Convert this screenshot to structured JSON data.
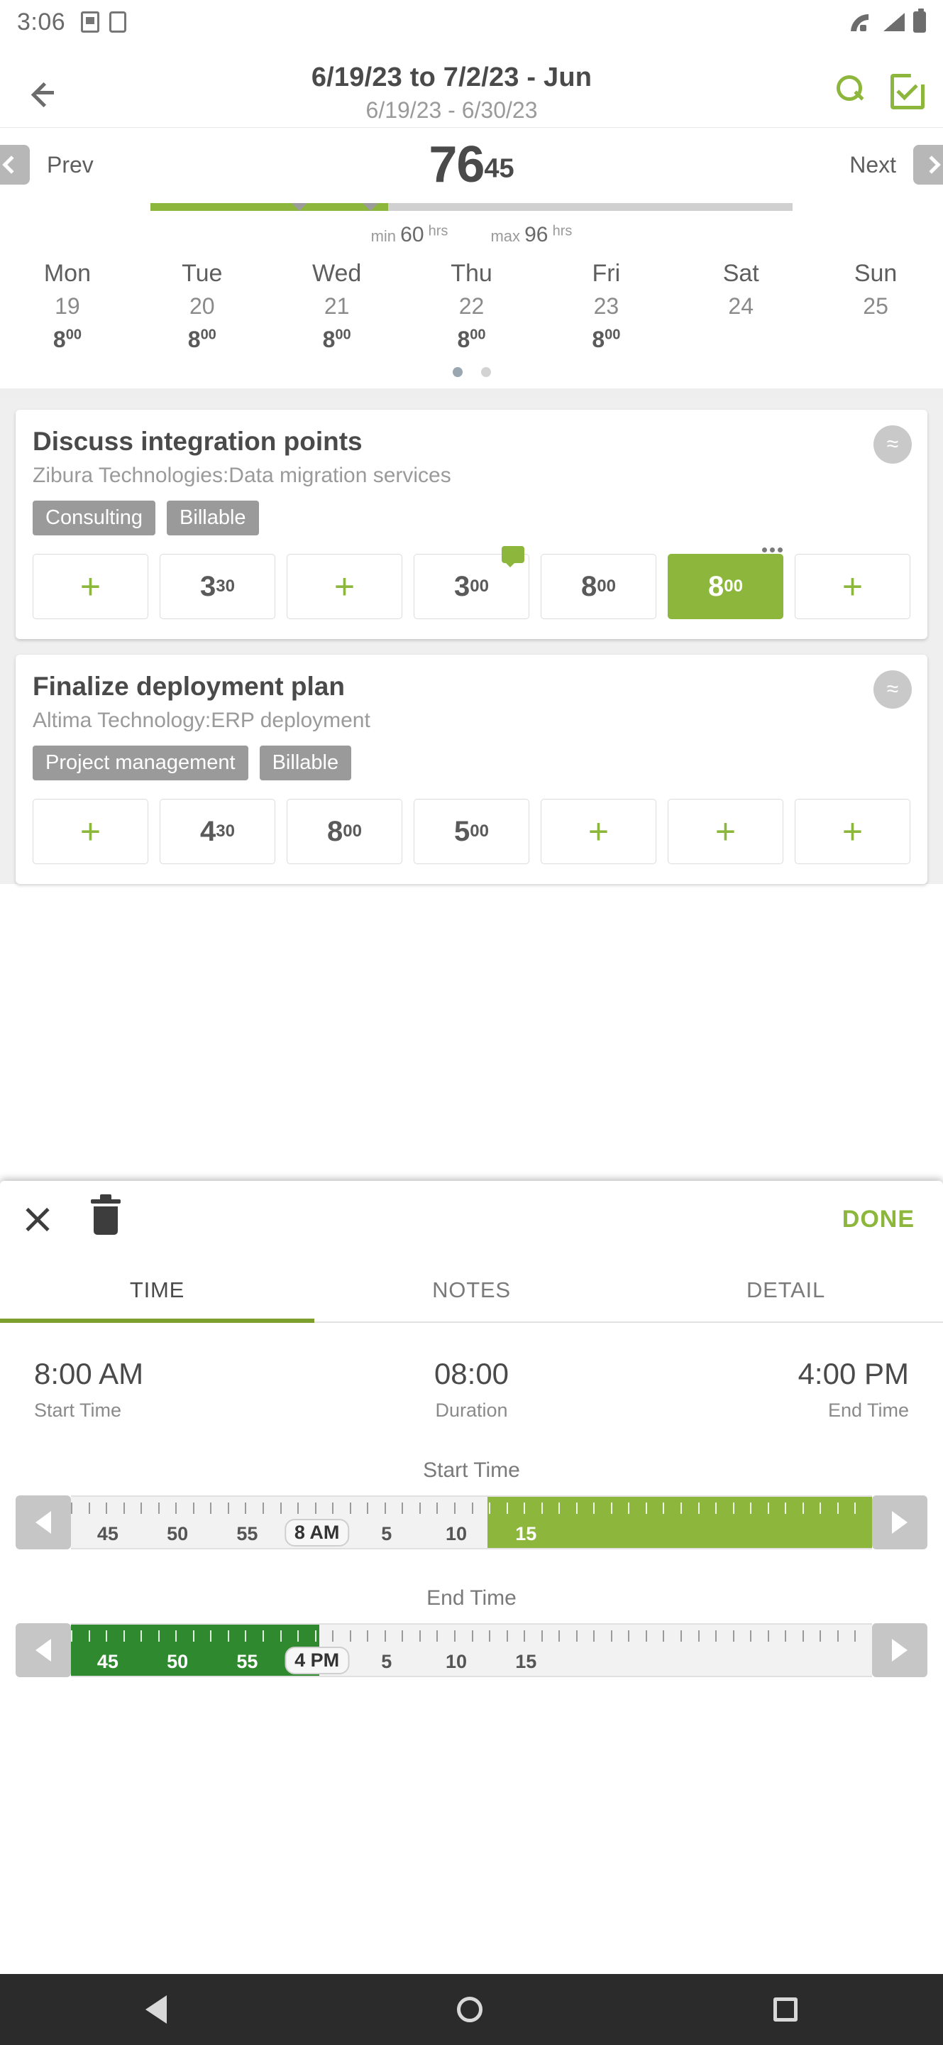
{
  "statusbar": {
    "time": "3:06"
  },
  "header": {
    "title": "6/19/23 to 7/2/23 - Jun",
    "subtitle": "6/19/23 - 6/30/23",
    "back_icon": "back-arrow-icon",
    "search_icon": "search-icon",
    "approve_icon": "checklist-icon"
  },
  "week": {
    "prev_label": "Prev",
    "next_label": "Next",
    "total_hours": "76",
    "total_minutes": "45",
    "min_label": "min",
    "min_value": "60",
    "min_unit": "hrs",
    "max_label": "max",
    "max_value": "96",
    "max_unit": "hrs",
    "progress_pct": 37,
    "marker_positions": [
      22,
      33
    ],
    "days": [
      {
        "name": "Mon",
        "date": "19",
        "hours": "8",
        "minutes": "00"
      },
      {
        "name": "Tue",
        "date": "20",
        "hours": "8",
        "minutes": "00"
      },
      {
        "name": "Wed",
        "date": "21",
        "hours": "8",
        "minutes": "00"
      },
      {
        "name": "Thu",
        "date": "22",
        "hours": "8",
        "minutes": "00"
      },
      {
        "name": "Fri",
        "date": "23",
        "hours": "8",
        "minutes": "00"
      },
      {
        "name": "Sat",
        "date": "24",
        "hours": "",
        "minutes": ""
      },
      {
        "name": "Sun",
        "date": "25",
        "hours": "",
        "minutes": ""
      }
    ],
    "page_dots": 2,
    "active_dot": 0
  },
  "tasks": [
    {
      "title": "Discuss integration points",
      "project": "Zibura Technologies:Data migration services",
      "tags": [
        "Consulting",
        "Billable"
      ],
      "collapse_glyph": "≈",
      "slots": [
        {
          "type": "add",
          "label": "+"
        },
        {
          "type": "value",
          "hours": "3",
          "minutes": "30"
        },
        {
          "type": "add",
          "label": "+"
        },
        {
          "type": "value",
          "hours": "3",
          "minutes": "00",
          "note": true
        },
        {
          "type": "value",
          "hours": "8",
          "minutes": "00"
        },
        {
          "type": "value",
          "hours": "8",
          "minutes": "00",
          "selected": true,
          "dots": true
        },
        {
          "type": "add",
          "label": "+"
        }
      ]
    },
    {
      "title": "Finalize deployment plan",
      "project": "Altima Technology:ERP deployment",
      "tags": [
        "Project management",
        "Billable"
      ],
      "collapse_glyph": "≈",
      "slots": [
        {
          "type": "add",
          "label": "+"
        },
        {
          "type": "value",
          "hours": "4",
          "minutes": "30"
        },
        {
          "type": "value",
          "hours": "8",
          "minutes": "00"
        },
        {
          "type": "value",
          "hours": "5",
          "minutes": "00"
        },
        {
          "type": "add",
          "label": "+"
        },
        {
          "type": "add",
          "label": "+"
        },
        {
          "type": "add",
          "label": "+"
        }
      ]
    }
  ],
  "sheet": {
    "close_icon": "close-icon",
    "delete_icon": "trash-icon",
    "done_label": "DONE",
    "tabs": [
      {
        "label": "TIME",
        "active": true
      },
      {
        "label": "NOTES",
        "active": false
      },
      {
        "label": "DETAIL",
        "active": false
      }
    ],
    "start_time_value": "8:00 AM",
    "start_time_label": "Start Time",
    "duration_value": "08:00",
    "duration_label": "Duration",
    "end_time_value": "4:00 PM",
    "end_time_label": "End Time",
    "start_slider": {
      "caption": "Start Time",
      "cursor_label": "8 AM",
      "ticks": [
        "45",
        "50",
        "55",
        "8 AM",
        "5",
        "10",
        "15"
      ],
      "left_arrow": "left-arrow-icon",
      "right_arrow": "right-arrow-icon"
    },
    "end_slider": {
      "caption": "End Time",
      "cursor_label": "4 PM",
      "ticks": [
        "45",
        "50",
        "55",
        "4 PM",
        "5",
        "10",
        "15"
      ],
      "left_arrow": "left-arrow-icon",
      "right_arrow": "right-arrow-icon"
    }
  },
  "navbar": {
    "back": "android-back-icon",
    "home": "android-home-icon",
    "recents": "android-recents-icon"
  }
}
